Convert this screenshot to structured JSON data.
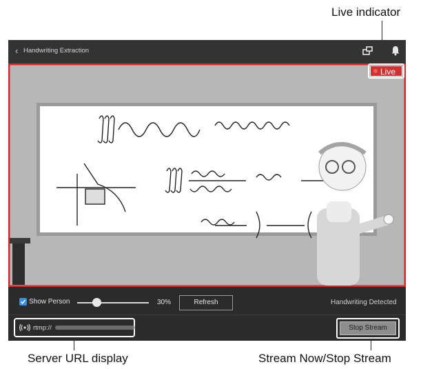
{
  "callouts": {
    "live": "Live indicator",
    "server_url": "Server URL display",
    "stream": "Stream Now/Stop Stream"
  },
  "app": {
    "title": "Handwriting Extraction",
    "back_icon": "chevron-left",
    "icons": [
      "monitor-icon",
      "bell-icon"
    ]
  },
  "video": {
    "live_label": "Live",
    "border_color": "#d42a2a"
  },
  "controls": {
    "show_person_label": "Show Person",
    "show_person_checked": true,
    "slider_percent": 30,
    "slider_value_label": "30%",
    "refresh_label": "Refresh",
    "status_text": "Handwriting Detected"
  },
  "stream": {
    "url_prefix": "rtmp://",
    "button_label": "Stop Stream"
  }
}
